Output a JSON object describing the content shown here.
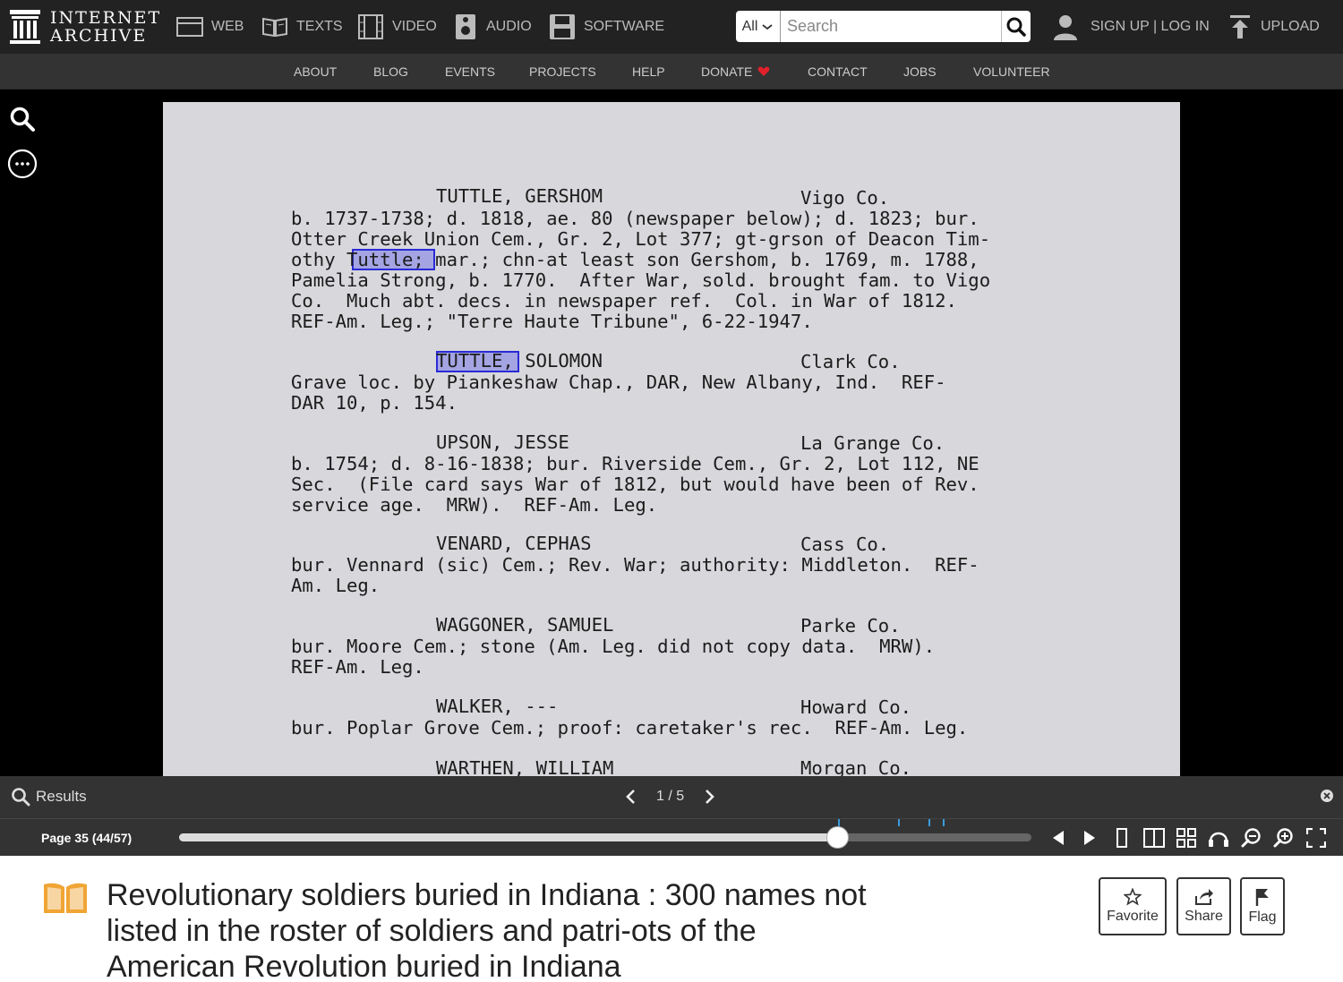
{
  "topnav": {
    "logo_line1": "INTERNET",
    "logo_line2": "ARCHIVE",
    "media": [
      {
        "label": "WEB",
        "icon": "web-icon"
      },
      {
        "label": "TEXTS",
        "icon": "texts-icon"
      },
      {
        "label": "VIDEO",
        "icon": "video-icon"
      },
      {
        "label": "AUDIO",
        "icon": "audio-icon"
      },
      {
        "label": "SOFTWARE",
        "icon": "software-icon"
      }
    ],
    "search_scope": "All",
    "search_placeholder": "Search",
    "user_label": "SIGN UP | LOG IN",
    "upload_label": "UPLOAD"
  },
  "subnav": [
    "ABOUT",
    "BLOG",
    "EVENTS",
    "PROJECTS",
    "HELP",
    "DONATE",
    "CONTACT",
    "JOBS",
    "VOLUNTEER"
  ],
  "page_text": {
    "lines": [
      "TUTTLE, GERSHOM",
      "Vigo Co.",
      "b. 1737-1738; d. 1818, ae. 80 (newspaper below); d. 1823; bur.",
      "Otter Creek Union Cem., Gr. 2, Lot 377; gt-grson of Deacon Tim-",
      "othy Tuttle; mar.; chn-at least son Gershom, b. 1769, m. 1788,",
      "Pamelia Strong, b. 1770.  After War, sold. brought fam. to Vigo",
      "Co.  Much abt. decs. in newspaper ref.  Col. in War of 1812.",
      "REF-Am. Leg.; \"Terre Haute Tribune\", 6-22-1947.",
      "TUTTLE, SOLOMON",
      "Clark Co.",
      "Grave loc. by Piankeshaw Chap., DAR, New Albany, Ind.  REF-",
      "DAR 10, p. 154.",
      "UPSON, JESSE",
      "La Grange Co.",
      "b. 1754; d. 8-16-1838; bur. Riverside Cem., Gr. 2, Lot 112, NE",
      "Sec.  (File card says War of 1812, but would have been of Rev.",
      "service age.  MRW).  REF-Am. Leg.",
      "VENARD, CEPHAS",
      "Cass Co.",
      "bur. Vennard (sic) Cem.; Rev. War; authority: Middleton.  REF-",
      "Am. Leg.",
      "WAGGONER, SAMUEL",
      "Parke Co.",
      "bur. Moore Cem.; stone (Am. Leg. did not copy data.  MRW).",
      "REF-Am. Leg.",
      "WALKER, ---",
      "Howard Co.",
      "bur. Poplar Grove Cem.; proof: caretaker's rec.  REF-Am. Leg.",
      "WARTHEN, WILLIAM",
      "Morgan Co."
    ]
  },
  "results": {
    "label": "Results",
    "counter": "1 / 5"
  },
  "navbar": {
    "page_label": "Page 35 (44/57)",
    "progress": 0.7717
  },
  "item": {
    "title": "Revolutionary soldiers buried in Indiana : 300 names not listed in the roster of soldiers and patri-ots of the American Revolution buried in Indiana",
    "favorite": "Favorite",
    "share": "Share",
    "flag": "Flag"
  },
  "colors": {
    "accent_heart": "#e0202a",
    "tick": "#3a9bdc",
    "book": "#f0a534"
  }
}
